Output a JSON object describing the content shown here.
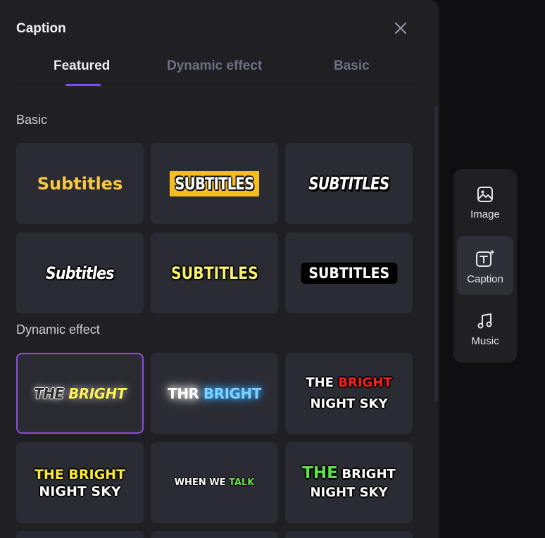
{
  "panel": {
    "title": "Caption",
    "tabs": [
      {
        "label": "Featured",
        "active": true
      },
      {
        "label": "Dynamic effect",
        "active": false
      },
      {
        "label": "Basic",
        "active": false
      }
    ]
  },
  "sections": {
    "basic": {
      "title": "Basic",
      "items": [
        "Subtitles",
        "SUBTITLES",
        "SUBTITLES",
        "Subtitles",
        "SUBTITLES",
        "SUBTITLES"
      ]
    },
    "dynamic": {
      "title": "Dynamic effect",
      "items": [
        {
          "parts": [
            "THE",
            "BRIGHT"
          ]
        },
        {
          "parts": [
            "THR",
            "BRIGHT"
          ]
        },
        {
          "parts": [
            "THE",
            "BRIGHT",
            "NIGHT SKY"
          ]
        },
        {
          "parts": [
            "THE BRIGHT",
            "NIGHT SKY"
          ]
        },
        {
          "parts": [
            "WHEN WE",
            "TALK"
          ]
        },
        {
          "parts": [
            "THE",
            "BRIGHT",
            "NIGHT SKY"
          ]
        }
      ]
    }
  },
  "toolbar": {
    "items": [
      {
        "label": "Image",
        "icon": "image-icon",
        "active": false
      },
      {
        "label": "Caption",
        "icon": "caption-text-icon",
        "active": true
      },
      {
        "label": "Music",
        "icon": "music-note-icon",
        "active": false
      }
    ]
  },
  "colors": {
    "accent": "#7c4dff",
    "selected_border": "#8b4ddb",
    "panel_bg": "#1f1f24",
    "tile_bg": "#2b2b33"
  }
}
